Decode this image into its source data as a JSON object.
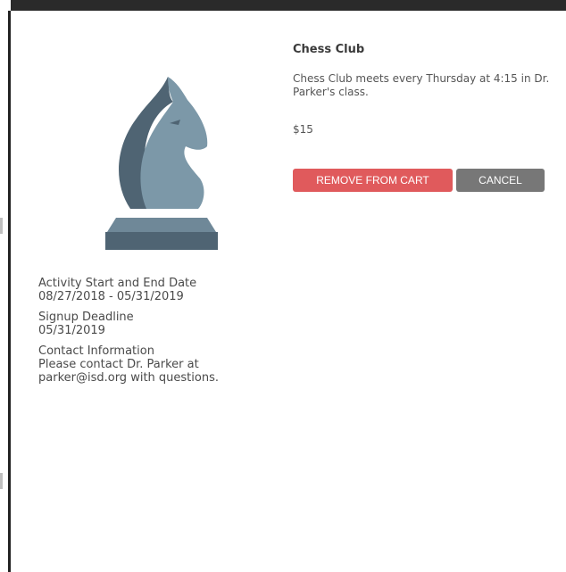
{
  "activity": {
    "title": "Chess Club",
    "description": "Chess Club meets every Thursday at 4:15 in Dr. Parker's class.",
    "price": "$15",
    "icon": "chess-knight-icon"
  },
  "details": {
    "dates": {
      "label": "Activity Start and End Date",
      "value": "08/27/2018 - 05/31/2019"
    },
    "deadline": {
      "label": "Signup Deadline",
      "value": "05/31/2019"
    },
    "contact": {
      "label": "Contact Information",
      "value": "Please contact Dr. Parker at parker@isd.org with questions."
    }
  },
  "actions": {
    "remove_label": "REMOVE FROM CART",
    "cancel_label": "CANCEL"
  },
  "colors": {
    "remove_button": "#e05a5c",
    "cancel_button": "#777777",
    "knight_dark": "#4f6473",
    "knight_light": "#7c98a8"
  }
}
